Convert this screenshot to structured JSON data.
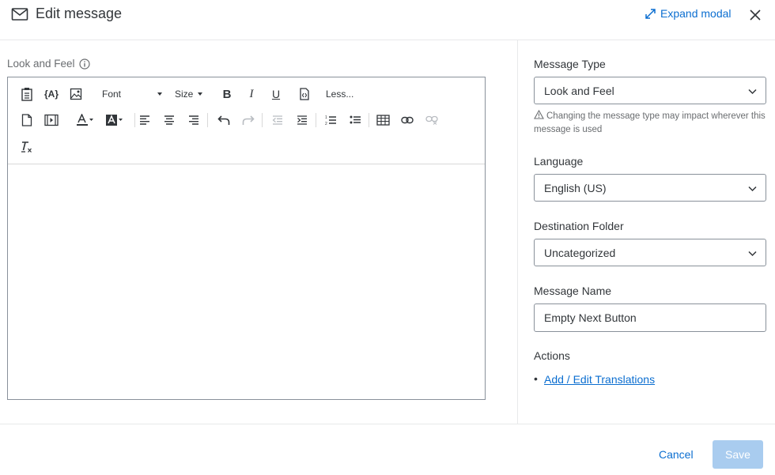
{
  "header": {
    "title": "Edit message",
    "expand_label": "Expand modal"
  },
  "editor": {
    "label": "Look and Feel",
    "font_label": "Font",
    "size_label": "Size",
    "less_label": "Less..."
  },
  "panel": {
    "message_type": {
      "label": "Message Type",
      "value": "Look and Feel",
      "note": "Changing the message type may impact wherever this message is used"
    },
    "language": {
      "label": "Language",
      "value": "English (US)"
    },
    "destination_folder": {
      "label": "Destination Folder",
      "value": "Uncategorized"
    },
    "message_name": {
      "label": "Message Name",
      "value": "Empty Next Button"
    },
    "actions": {
      "label": "Actions",
      "link": "Add / Edit Translations"
    }
  },
  "footer": {
    "cancel_label": "Cancel",
    "save_label": "Save"
  },
  "colors": {
    "accent": "#0b6ed0",
    "save_disabled": "#a9ccef",
    "border": "#89919a"
  }
}
